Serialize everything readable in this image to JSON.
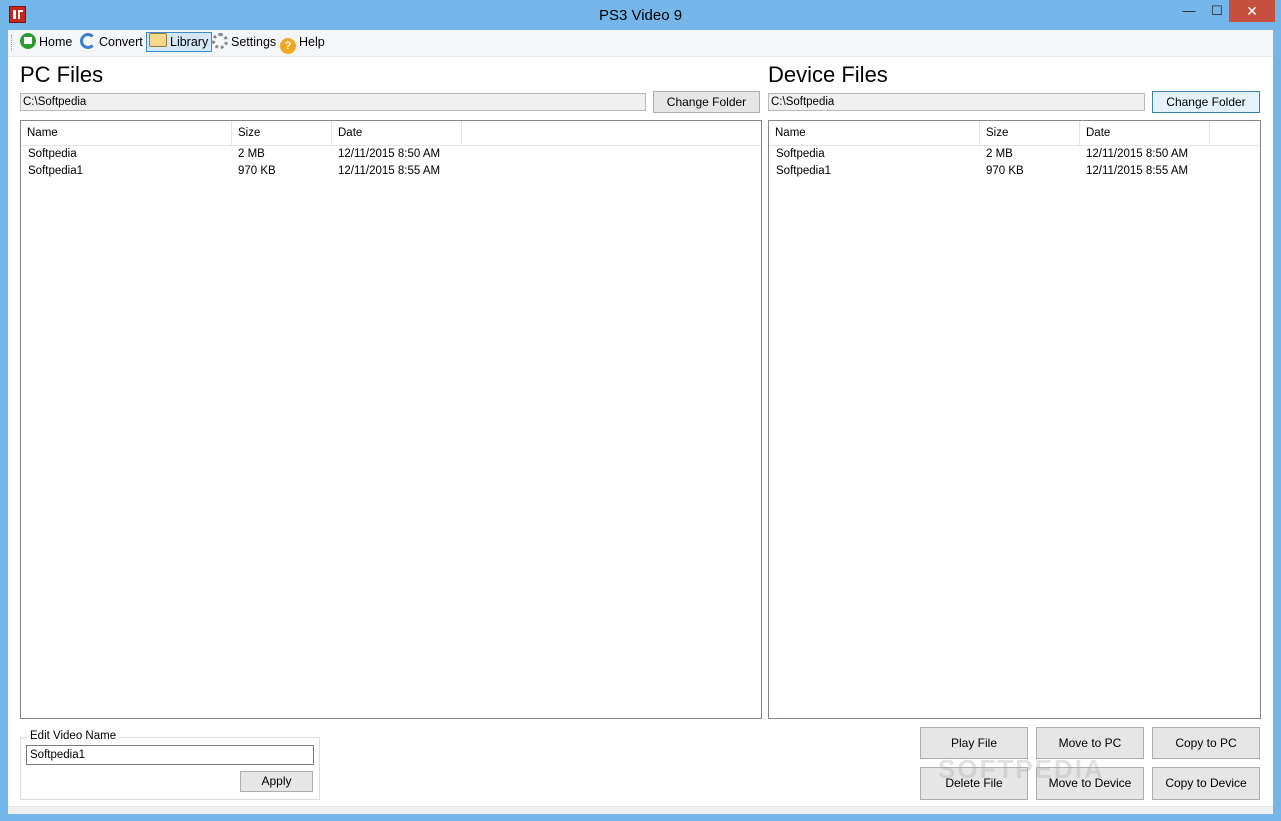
{
  "window": {
    "title": "PS3 Video 9",
    "min_glyph": "—",
    "max_glyph": "☐",
    "close_glyph": "✕"
  },
  "toolbar": {
    "items": [
      {
        "label": "Home",
        "icon": "home-icon"
      },
      {
        "label": "Convert",
        "icon": "convert-icon"
      },
      {
        "label": "Library",
        "icon": "library-icon",
        "active": true
      },
      {
        "label": "Settings",
        "icon": "settings-icon"
      },
      {
        "label": "Help",
        "icon": "help-icon"
      }
    ]
  },
  "pc": {
    "title": "PC Files",
    "path": "C:\\Softpedia",
    "change_folder": "Change Folder",
    "columns": [
      "Name",
      "Size",
      "Date"
    ],
    "rows": [
      {
        "name": "Softpedia",
        "size": "2 MB",
        "date": "12/11/2015 8:50 AM"
      },
      {
        "name": "Softpedia1",
        "size": "970 KB",
        "date": "12/11/2015 8:55 AM"
      }
    ]
  },
  "device": {
    "title": "Device Files",
    "path": "C:\\Softpedia",
    "change_folder": "Change Folder",
    "columns": [
      "Name",
      "Size",
      "Date"
    ],
    "rows": [
      {
        "name": "Softpedia",
        "size": "2 MB",
        "date": "12/11/2015 8:50 AM"
      },
      {
        "name": "Softpedia1",
        "size": "970 KB",
        "date": "12/11/2015 8:55 AM"
      }
    ]
  },
  "edit": {
    "group_label": "Edit Video Name",
    "value": "Softpedia1",
    "apply": "Apply"
  },
  "actions": {
    "play_file": "Play File",
    "move_to_pc": "Move to PC",
    "copy_to_pc": "Copy to PC",
    "delete_file": "Delete File",
    "move_to_device": "Move to Device",
    "copy_to_device": "Copy to Device"
  },
  "watermark": "SOFTPEDIA"
}
